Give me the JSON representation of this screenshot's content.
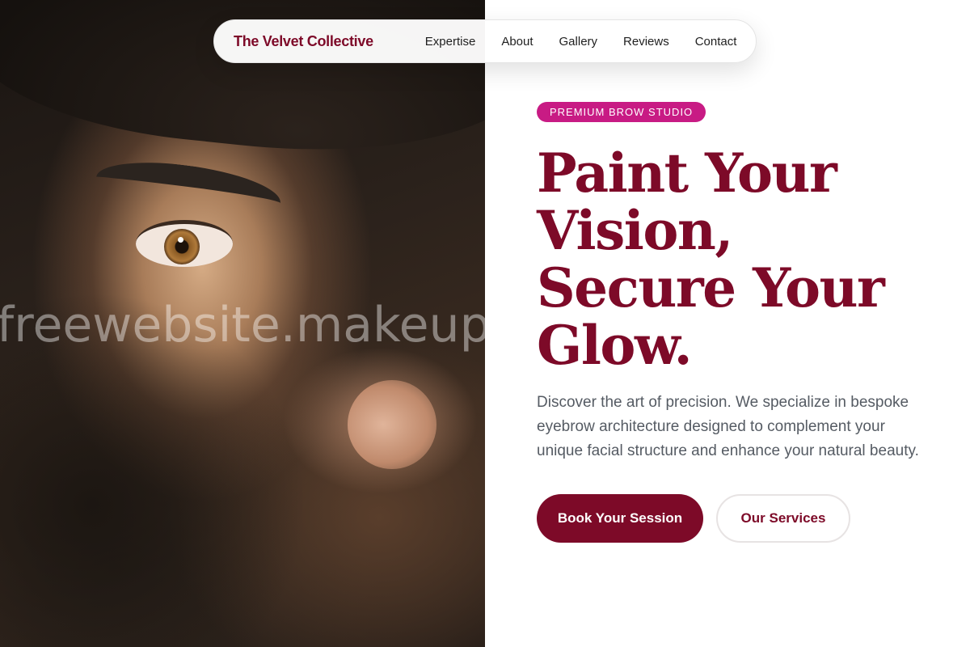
{
  "nav": {
    "brand": "The Velvet Collective",
    "links": [
      {
        "label": "Expertise"
      },
      {
        "label": "About"
      },
      {
        "label": "Gallery"
      },
      {
        "label": "Reviews"
      },
      {
        "label": "Contact"
      }
    ]
  },
  "hero": {
    "badge": "PREMIUM BROW STUDIO",
    "headline_lines": [
      "Paint Your",
      "Vision,",
      "Secure Your",
      "Glow."
    ],
    "description": "Discover the art of precision. We specialize in bespoke eyebrow architecture designed to complement your unique facial structure and enhance your natural beauty.",
    "primary_cta": "Book Your Session",
    "secondary_cta": "Our Services"
  },
  "watermark": "freewebsite.makeup",
  "colors": {
    "brand": "#7d0a28",
    "badge": "#c81b84",
    "body_text": "#555b63"
  }
}
